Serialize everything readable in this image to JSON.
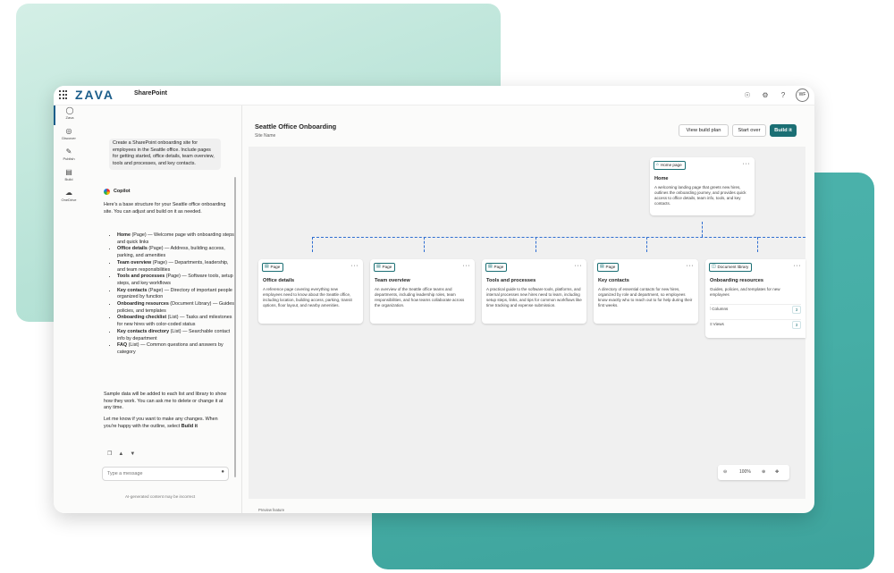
{
  "brand": {
    "logo": "ZAVA",
    "app_name": "SharePoint",
    "user_initials": "WF"
  },
  "rail": [
    {
      "label": "Zava",
      "icon": "copilot-icon"
    },
    {
      "label": "Discover",
      "icon": "discover-icon"
    },
    {
      "label": "Publish",
      "icon": "publish-icon"
    },
    {
      "label": "Build",
      "icon": "build-icon"
    },
    {
      "label": "OneDrive",
      "icon": "onedrive-icon"
    }
  ],
  "chat": {
    "prompt": "Create a SharePoint onboarding site for employees in the Seattle office. Include pages for getting started, office details, team overview, tools and processes, and key contacts.",
    "assistant_name": "Copilot",
    "intro": "Here's a base structure for your Seattle office onboarding site. You can adjust and build on it as needed.",
    "structure": [
      {
        "name": "Home",
        "detail": " (Page) — Welcome page with onboarding steps and quick links"
      },
      {
        "name": "Office details",
        "detail": " (Page) — Address, building access, parking, and amenities"
      },
      {
        "name": "Team overview",
        "detail": " (Page) — Departments, leadership, and team responsibilities"
      },
      {
        "name": "Tools and processes",
        "detail": " (Page) — Software tools, setup steps, and key workflows"
      },
      {
        "name": "Key contacts",
        "detail": " (Page) — Directory of important people organized by function"
      },
      {
        "name": "Onboarding resources",
        "detail": " (Document Library) — Guides, policies, and templates"
      },
      {
        "name": "Onboarding checklist",
        "detail": " (List) — Tasks and milestones for new hires with color-coded status"
      },
      {
        "name": "Key contacts directory",
        "detail": " (List) — Searchable contact info by department"
      },
      {
        "name": "FAQ",
        "detail": " (List) — Common questions and answers by category"
      }
    ],
    "sample_note": "Sample data will be added to each list and library to show how they work. You can ask me to delete or change it at any time.",
    "closing_text": "Let me know if you want to make any changes. When you're happy with the outline, select ",
    "closing_action": "Build it",
    "input_placeholder": "Type a message",
    "disclaimer": "AI-generated content may be incorrect"
  },
  "main": {
    "site_title": "Seattle Office Onboarding",
    "site_subtitle": "Site Name",
    "buttons": {
      "view_plan": "View build plan",
      "start_over": "Start over",
      "build": "Build it"
    },
    "home_card": {
      "badge": "Home page",
      "title": "Home",
      "desc": "A welcoming landing page that greets new hires, outlines the onboarding journey, and provides quick access to office details, team info, tools, and key contacts."
    },
    "cards": [
      {
        "badge": "Page",
        "title": "Office details",
        "desc": "A reference page covering everything new employees need to know about the Seattle office, including location, building access, parking, transit options, floor layout, and nearby amenities."
      },
      {
        "badge": "Page",
        "title": "Team overview",
        "desc": "An overview of the Seattle office teams and departments, including leadership roles, team responsibilities, and how teams collaborate across the organization."
      },
      {
        "badge": "Page",
        "title": "Tools and processes",
        "desc": "A practical guide to the software tools, platforms, and internal processes new hires need to learn, including setup steps, links, and tips for common workflows like time tracking and expense submission."
      },
      {
        "badge": "Page",
        "title": "Key contacts",
        "desc": "A directory of essential contacts for new hires, organized by role and department, so employees know exactly who to reach out to for help during their first weeks."
      }
    ],
    "library_card": {
      "badge": "Document library",
      "title": "Onboarding resources",
      "desc": "Guides, policies, and templates for new employees",
      "rows": [
        {
          "label": "Columns",
          "count": "3"
        },
        {
          "label": "Views",
          "count": "3"
        }
      ]
    },
    "zoom_level": "100%",
    "preview_label": "Preview feature"
  }
}
